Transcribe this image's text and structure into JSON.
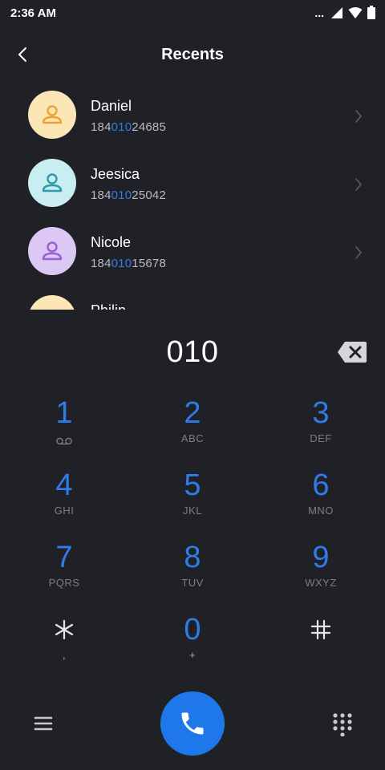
{
  "status_bar": {
    "time": "2:36 AM",
    "dots": "..."
  },
  "header": {
    "title": "Recents"
  },
  "contacts": [
    {
      "name": "Daniel",
      "number_prefix": "184",
      "number_match": "010",
      "number_suffix": "24685",
      "avatar_bg": "#fde6b6",
      "avatar_icon": "#f0a030"
    },
    {
      "name": "Jeesica",
      "number_prefix": "184",
      "number_match": "010",
      "number_suffix": "25042",
      "avatar_bg": "#c8eef2",
      "avatar_icon": "#2a9ea8"
    },
    {
      "name": "Nicole",
      "number_prefix": "184",
      "number_match": "010",
      "number_suffix": "15678",
      "avatar_bg": "#dcc8f4",
      "avatar_icon": "#9b5fd3"
    },
    {
      "name": "Philip",
      "number_prefix": "",
      "number_match": "",
      "number_suffix": "",
      "avatar_bg": "#fde6b6",
      "avatar_icon": "#f0a030"
    }
  ],
  "dial": {
    "value": "010"
  },
  "keypad": [
    {
      "digit": "1",
      "letters": ""
    },
    {
      "digit": "2",
      "letters": "ABC"
    },
    {
      "digit": "3",
      "letters": "DEF"
    },
    {
      "digit": "4",
      "letters": "GHI"
    },
    {
      "digit": "5",
      "letters": "JKL"
    },
    {
      "digit": "6",
      "letters": "MNO"
    },
    {
      "digit": "7",
      "letters": "PQRS"
    },
    {
      "digit": "8",
      "letters": "TUV"
    },
    {
      "digit": "9",
      "letters": "WXYZ"
    },
    {
      "digit": "*",
      "letters": ","
    },
    {
      "digit": "0",
      "letters": "+"
    },
    {
      "digit": "#",
      "letters": ""
    }
  ],
  "colors": {
    "background": "#202126",
    "accent": "#2f7be8",
    "call_button": "#1f78ea"
  },
  "icons": {
    "back": "chevron-left-icon",
    "backspace": "backspace-icon",
    "menu": "menu-icon",
    "call": "phone-icon",
    "dialpad": "dialpad-icon",
    "voicemail": "voicemail-icon"
  }
}
